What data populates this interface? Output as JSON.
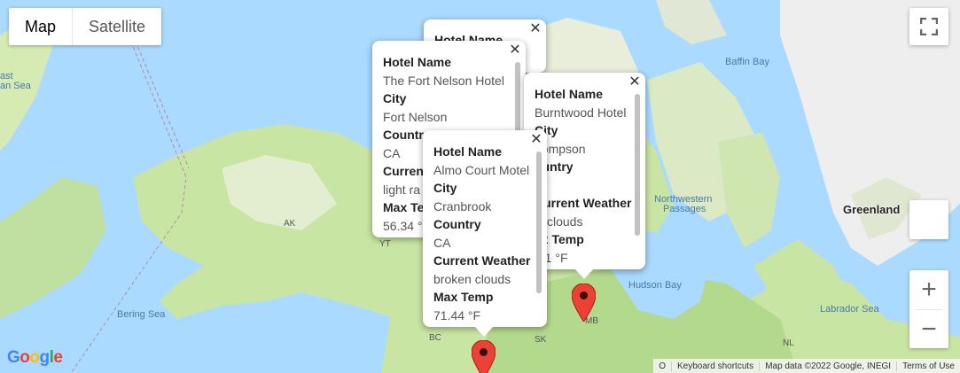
{
  "map_type": {
    "map_label": "Map",
    "satellite_label": "Satellite",
    "selected": "Map"
  },
  "controls": {
    "fullscreen_icon": "fullscreen-icon",
    "zoom_in": "+",
    "zoom_out": "−"
  },
  "labels": {
    "east_siberian_1": "ast",
    "east_siberian_2": "an Sea",
    "baffin_bay": "Baffin Bay",
    "northwestern_passages_1": "Northwestern",
    "northwestern_passages_2": "Passages",
    "greenland": "Greenland",
    "ak": "AK",
    "yt": "YT",
    "bering_sea": "Bering Sea",
    "hudson_bay": "Hudson Bay",
    "labrador_sea": "Labrador Sea",
    "bc": "BC",
    "sk": "SK",
    "mb": "MB",
    "nl": "NL"
  },
  "popups": [
    {
      "id": "hidden",
      "rows": [
        {
          "k": "Hotel Name",
          "v": ""
        }
      ]
    },
    {
      "id": "fort_nelson",
      "rows": [
        {
          "k": "Hotel Name",
          "v": "The Fort Nelson Hotel"
        },
        {
          "k": "City",
          "v": "Fort Nelson"
        },
        {
          "k": "Countr",
          "v": "CA"
        },
        {
          "k": "Current ra",
          "v": "light ra"
        },
        {
          "k": "Max Tem",
          "v": "56.34 °"
        }
      ]
    },
    {
      "id": "thompson",
      "rows": [
        {
          "k": "Hotel Name",
          "v": "Burntwood Hotel"
        },
        {
          "k": "City",
          "v": "hompson"
        },
        {
          "k": "ountry",
          "v": "A"
        },
        {
          "k": "Current Weather",
          "v": "w clouds"
        },
        {
          "k": "ax Temp",
          "v": ".61 °F"
        }
      ]
    },
    {
      "id": "cranbrook",
      "rows": [
        {
          "k": "Hotel Name",
          "v": "Almo Court Motel"
        },
        {
          "k": "City",
          "v": "Cranbrook"
        },
        {
          "k": "Country",
          "v": "CA"
        },
        {
          "k": "Current Weather",
          "v": "broken clouds"
        },
        {
          "k": "Max Temp",
          "v": "71.44 °F"
        }
      ]
    }
  ],
  "close_symbol": "✕",
  "footer": {
    "partial": "O",
    "keyboard_shortcuts": "Keyboard shortcuts",
    "map_data": "Map data ©2022 Google, INEGI",
    "terms": "Terms of Use"
  },
  "google_logo": "Google",
  "colors": {
    "water": "#aadaff",
    "land": "#cbe6a3",
    "ice": "#f2f2f2",
    "pin": "#ea4335"
  }
}
